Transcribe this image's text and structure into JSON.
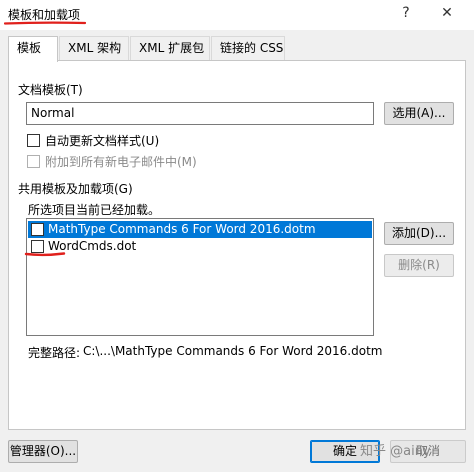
{
  "window": {
    "title": "模板和加载项",
    "help_glyph": "?",
    "close_glyph": "✕"
  },
  "tabs": [
    {
      "label": "模板"
    },
    {
      "label": "XML 架构"
    },
    {
      "label": "XML 扩展包"
    },
    {
      "label": "链接的 CSS"
    }
  ],
  "document_template": {
    "group_label": "文档模板(T)",
    "value": "Normal",
    "select_button": "选用(A)...",
    "auto_update_label": "自动更新文档样式(U)",
    "attach_all_label": "附加到所有新电子邮件中(M)"
  },
  "global_templates": {
    "group_label": "共用模板及加载项(G)",
    "hint": "所选项目当前已经加载。",
    "items": [
      {
        "label": "MathType Commands 6 For Word 2016.dotm"
      },
      {
        "label": "WordCmds.dot"
      }
    ],
    "add_button": "添加(D)...",
    "remove_button": "删除(R)",
    "full_path_label": "完整路径:",
    "full_path_value": "C:\\...\\MathType Commands 6 For Word 2016.dotm"
  },
  "footer": {
    "organizer_button": "管理器(O)...",
    "ok_button": "确定",
    "cancel_button": "取消"
  },
  "watermark": "知乎 @ainy",
  "colors": {
    "selection": "#0078d7",
    "annotation_red": "#e0201c"
  }
}
